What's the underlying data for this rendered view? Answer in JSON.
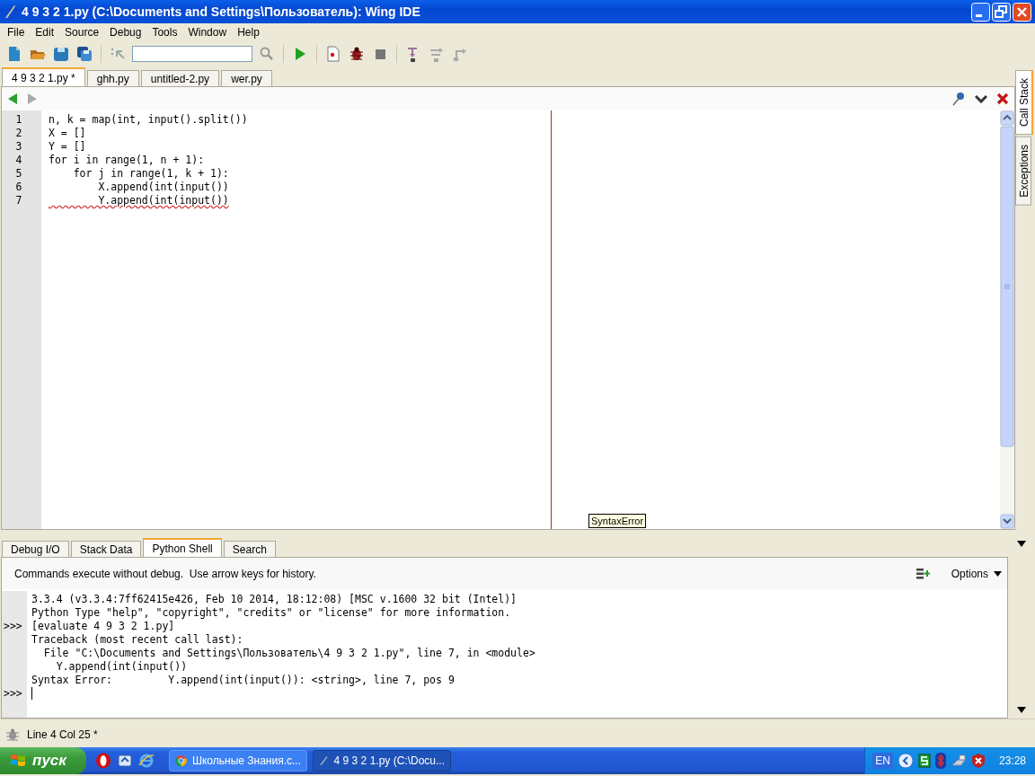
{
  "window": {
    "title": "4 9 3 2 1.py (C:\\Documents and Settings\\Пользователь): Wing IDE"
  },
  "menu": [
    "File",
    "Edit",
    "Source",
    "Debug",
    "Tools",
    "Window",
    "Help"
  ],
  "editor_tabs": [
    {
      "label": "4 9 3 2 1.py *",
      "selected": true
    },
    {
      "label": "ghh.py",
      "selected": false
    },
    {
      "label": "untitled-2.py",
      "selected": false
    },
    {
      "label": "wer.py",
      "selected": false
    }
  ],
  "editor": {
    "lines": [
      {
        "number": "1",
        "code": "n, k = map(int, input().split())",
        "error": false
      },
      {
        "number": "2",
        "code": "X = []",
        "error": false
      },
      {
        "number": "3",
        "code": "Y = []",
        "error": false
      },
      {
        "number": "4",
        "code": "for i in range(1, n + 1):",
        "error": false
      },
      {
        "number": "5",
        "code": "    for j in range(1, k + 1):",
        "error": false
      },
      {
        "number": "6",
        "code": "        X.append(int(input())",
        "error": false
      },
      {
        "number": "7",
        "code": "        Y.append(int(input())",
        "error": true
      }
    ],
    "tooltip": "SyntaxError"
  },
  "side_tabs": [
    {
      "label": "Call Stack",
      "selected": true
    },
    {
      "label": "Exceptions",
      "selected": false
    }
  ],
  "bottom_tabs": [
    {
      "label": "Debug I/O",
      "selected": false
    },
    {
      "label": "Stack Data",
      "selected": false
    },
    {
      "label": "Python Shell",
      "selected": true
    },
    {
      "label": "Search",
      "selected": false
    }
  ],
  "shell": {
    "hint": "Commands execute without debug.  Use arrow keys for history.",
    "options": "Options",
    "lines": [
      {
        "text": "3.3.4 (v3.3.4:7ff62415e426, Feb 10 2014, 18:12:08) [MSC v.1600 32 bit (Intel)]"
      },
      {
        "text": "Python Type \"help\", \"copyright\", \"credits\" or \"license\" for more information."
      },
      {
        "prompt": ">>>",
        "text": "[evaluate 4 9 3 2 1.py]"
      },
      {
        "text": "Traceback (most recent call last):"
      },
      {
        "text": "  File \"C:\\Documents and Settings\\Пользователь\\4 9 3 2 1.py\", line 7, in <module>"
      },
      {
        "text": "    Y.append(int(input())"
      },
      {
        "text": "Syntax Error:         Y.append(int(input()): <string>, line 7, pos 9"
      },
      {
        "prompt": ">>>",
        "cursor": true
      }
    ]
  },
  "status_bar": {
    "position": "Line 4 Col 25 *"
  },
  "taskbar": {
    "start": "пуск",
    "tasks": [
      {
        "label": "Школьные Знания.c...",
        "selected": false
      },
      {
        "label": "4 9 3 2 1.py (C:\\Docu...",
        "selected": true
      }
    ],
    "language": "EN",
    "clock": "23:28"
  }
}
